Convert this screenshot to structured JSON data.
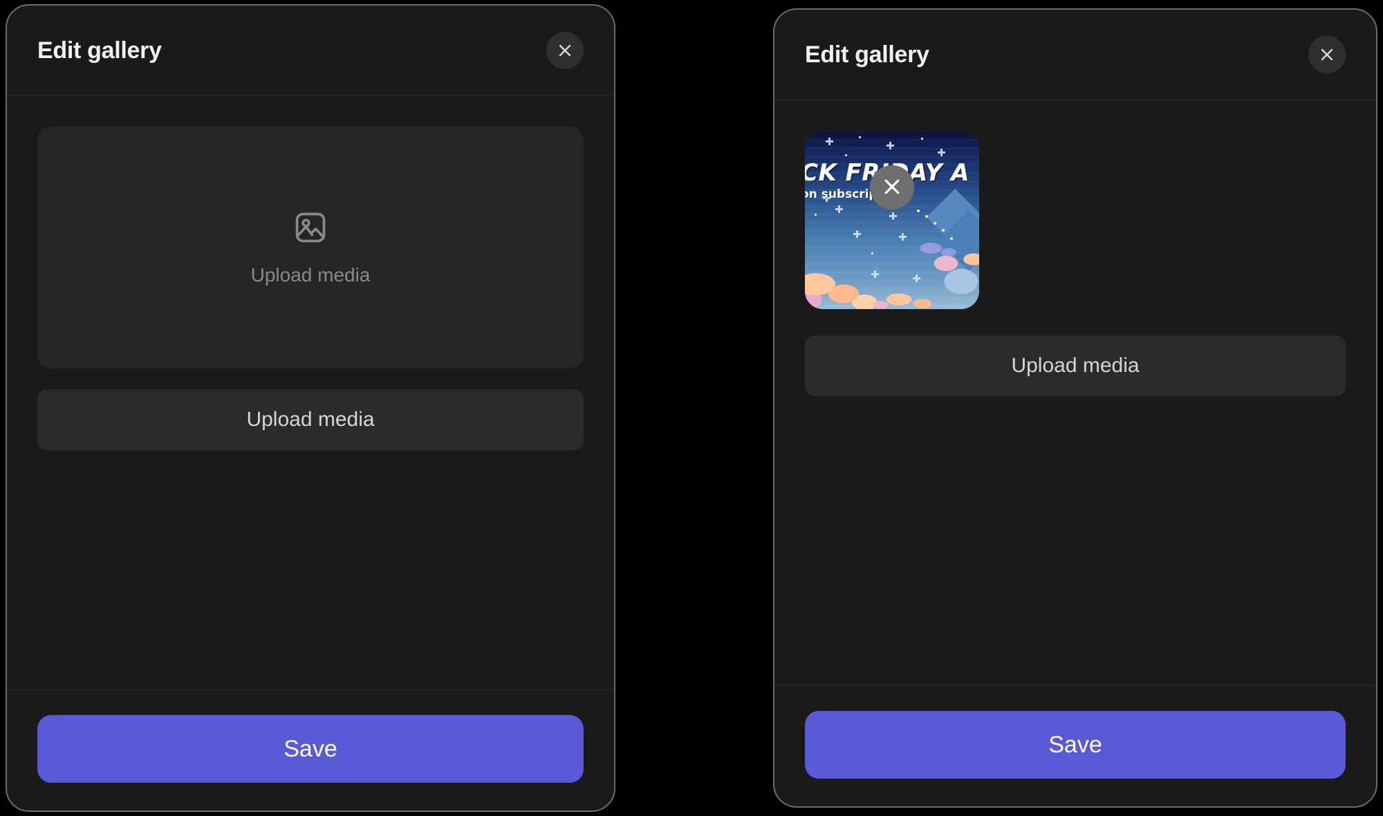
{
  "theme": {
    "page_background": "#000000",
    "modal_background": "#1a1a1a",
    "modal_border": "#6d6d6d",
    "divider": "#2b2b2b",
    "accent_save": "#5a5ad6",
    "dropzone_background": "#252525",
    "upload_button_background": "#2b2b2b",
    "muted_text": "#8a8a8a",
    "close_button_background": "#2f2f2f",
    "thumb_remove_background": "#6f6f6f"
  },
  "panels": [
    {
      "id": "empty-state",
      "header": {
        "title": "Edit gallery",
        "close_icon": "close-icon",
        "close_label": "Close"
      },
      "body": {
        "has_dropzone": true,
        "dropzone": {
          "icon": "image-placeholder-icon",
          "label": "Upload media"
        },
        "upload_button_label": "Upload media",
        "thumbnails": []
      },
      "footer": {
        "save_label": "Save"
      }
    },
    {
      "id": "with-media",
      "header": {
        "title": "Edit gallery",
        "close_icon": "close-icon",
        "close_label": "Close"
      },
      "body": {
        "has_dropzone": false,
        "upload_button_label": "Upload media",
        "thumbnails": [
          {
            "name": "black-friday-banner",
            "alt": "Black Friday sale pixel art banner",
            "overlay_headline": "CK FRIDAY A",
            "overlay_subtitle": "on subscriptions",
            "remove_icon": "close-icon",
            "remove_label": "Remove media"
          }
        ]
      },
      "footer": {
        "save_label": "Save"
      }
    }
  ]
}
